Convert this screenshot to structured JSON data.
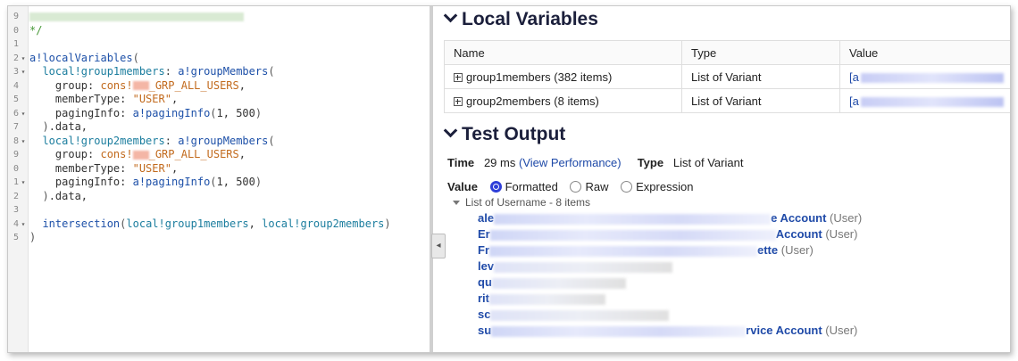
{
  "editor": {
    "lines": [
      {
        "n": "9",
        "fold": "",
        "html": "<span class='blur-box' style='width:240px;background:#d9ead3'></span>"
      },
      {
        "n": "0",
        "fold": "",
        "html": "<span class='k-cmt'>*/</span>"
      },
      {
        "n": "1",
        "fold": "",
        "html": ""
      },
      {
        "n": "2",
        "fold": "▾",
        "html": "<span class='k-fn'>a!localVariables</span><span class='k-par'>(</span>"
      },
      {
        "n": "3",
        "fold": "▾",
        "html": "  <span class='k-var'>local!group1members</span>: <span class='k-fn'>a!groupMembers</span><span class='k-par'>(</span>"
      },
      {
        "n": "4",
        "fold": "",
        "html": "    group: <span class='k-str'>cons!</span><span class='blur-box' style='width:18px'></span><span class='k-str'>_GRP_ALL_USERS</span>,"
      },
      {
        "n": "5",
        "fold": "",
        "html": "    memberType: <span class='k-str'>\"USER\"</span>,"
      },
      {
        "n": "6",
        "fold": "▾",
        "html": "    pagingInfo: <span class='k-fn'>a!pagingInfo</span><span class='k-par'>(</span>1, 500<span class='k-par'>)</span>"
      },
      {
        "n": "7",
        "fold": "",
        "html": "  <span class='k-par'>)</span>.data,"
      },
      {
        "n": "8",
        "fold": "▾",
        "html": "  <span class='k-var'>local!group2members</span>: <span class='k-fn'>a!groupMembers</span><span class='k-par'>(</span>"
      },
      {
        "n": "9",
        "fold": "",
        "html": "    group: <span class='k-str'>cons!</span><span class='blur-box' style='width:18px'></span><span class='k-str'>_GRP_ALL_USERS</span>,"
      },
      {
        "n": "0",
        "fold": "",
        "html": "    memberType: <span class='k-str'>\"USER\"</span>,"
      },
      {
        "n": "1",
        "fold": "▾",
        "html": "    pagingInfo: <span class='k-fn'>a!pagingInfo</span><span class='k-par'>(</span>1, 500<span class='k-par'>)</span>"
      },
      {
        "n": "2",
        "fold": "",
        "html": "  <span class='k-par'>)</span>.data,"
      },
      {
        "n": "3",
        "fold": "",
        "html": ""
      },
      {
        "n": "4",
        "fold": "▾",
        "html": "  <span class='k-fn'>intersection</span><span class='k-par'>(</span><span class='k-var'>local!group1members</span>, <span class='k-var'>local!group2members</span><span class='k-par'>)</span>"
      },
      {
        "n": "5",
        "fold": "",
        "html": "<span class='k-par'>)</span>"
      }
    ]
  },
  "local_variables": {
    "title": "Local Variables",
    "columns": [
      "Name",
      "Type",
      "Value"
    ],
    "rows": [
      {
        "name": "group1members (382 items)",
        "type": "List of Variant",
        "value_prefix": "[a"
      },
      {
        "name": "group2members (8 items)",
        "type": "List of Variant",
        "value_prefix": "[a"
      }
    ]
  },
  "test_output": {
    "title": "Test Output",
    "time_label": "Time",
    "time_value": "29 ms",
    "view_performance": "(View Performance)",
    "type_label": "Type",
    "type_value": "List of Variant",
    "value_label": "Value",
    "radio_options": [
      "Formatted",
      "Raw",
      "Expression"
    ],
    "selected_radio": "Formatted",
    "list_header": "List of Username - 8 items",
    "users": [
      {
        "visible": "ale",
        "suffix": "e Account",
        "tag": "(User)",
        "blur": 310
      },
      {
        "visible": "Er",
        "suffix": "Account",
        "tag": "(User)",
        "blur": 320
      },
      {
        "visible": "Fr",
        "suffix": "ette",
        "tag": "(User)",
        "blur": 300
      },
      {
        "visible": "lev",
        "suffix": "",
        "tag": "",
        "blur": 200
      },
      {
        "visible": "qu",
        "suffix": "",
        "tag": "",
        "blur": 150
      },
      {
        "visible": "rit",
        "suffix": "",
        "tag": "",
        "blur": 130
      },
      {
        "visible": "sc",
        "suffix": "",
        "tag": "",
        "blur": 200
      },
      {
        "visible": "su",
        "suffix": "rvice Account",
        "tag": "(User)",
        "blur": 285
      }
    ]
  },
  "splitter": {
    "collapse_glyph": "◂"
  }
}
